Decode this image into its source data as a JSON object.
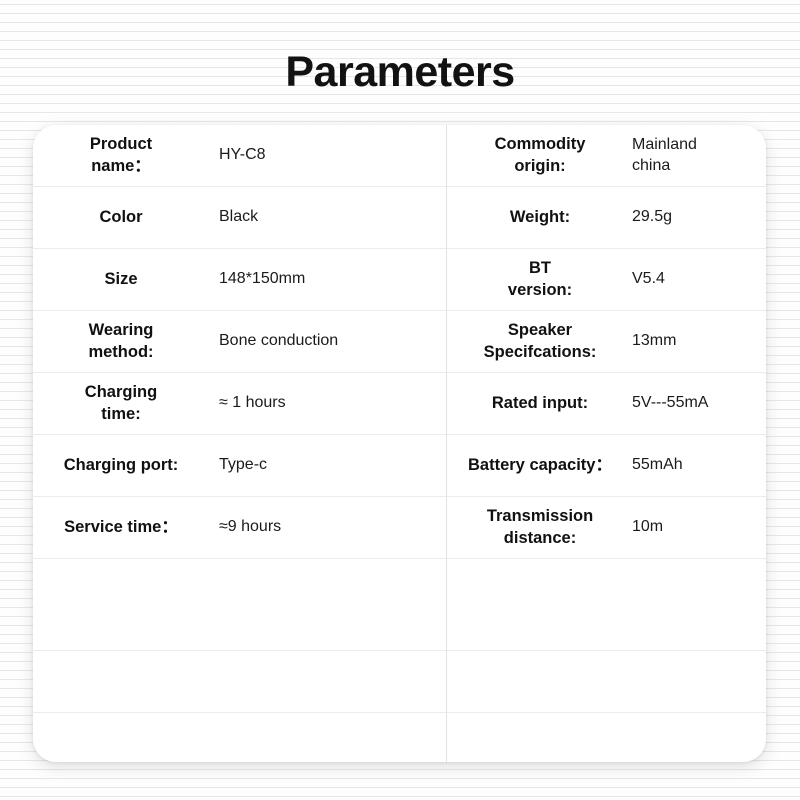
{
  "page": {
    "title": "Parameters",
    "background_color": "#f2f2f2",
    "card_color": "#ffffff",
    "text_color": "#111111",
    "divider_color": "#ececec"
  },
  "table": {
    "left_column": [
      {
        "label": "Product\nname：",
        "value": "HY-C8"
      },
      {
        "label": "Color",
        "value": "Black"
      },
      {
        "label": "Size",
        "value": "148*150mm"
      },
      {
        "label": "Wearing\nmethod:",
        "value": "Bone conduction"
      },
      {
        "label": "Charging\ntime:",
        "value": "≈ 1 hours"
      },
      {
        "label": "Charging port:",
        "value": "Type-c"
      },
      {
        "label": "Service time：",
        "value": "≈9 hours"
      },
      {
        "label": "",
        "value": ""
      },
      {
        "label": "",
        "value": ""
      },
      {
        "label": "",
        "value": ""
      }
    ],
    "right_column": [
      {
        "label": "Commodity\norigin:",
        "value": "Mainland\nchina"
      },
      {
        "label": "Weight:",
        "value": "29.5g"
      },
      {
        "label": "BT\nversion:",
        "value": "V5.4"
      },
      {
        "label": "Speaker\nSpecifcations:",
        "value": "13mm"
      },
      {
        "label": "Rated input:",
        "value": "5V---55mA"
      },
      {
        "label": "Battery capacity：",
        "value": "55mAh"
      },
      {
        "label": "Transmission\ndistance:",
        "value": "10m"
      },
      {
        "label": "",
        "value": ""
      },
      {
        "label": "",
        "value": ""
      },
      {
        "label": "",
        "value": ""
      }
    ]
  }
}
